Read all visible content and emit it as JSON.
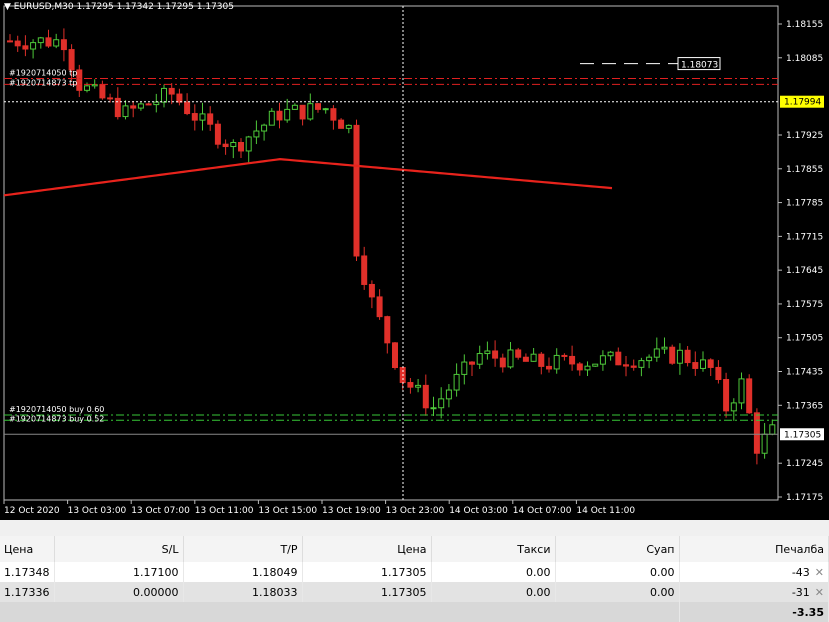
{
  "chart": {
    "symbol": "EURUSD,M30",
    "ohlc": "1.17295 1.17342 1.17295 1.17305",
    "price_ticks": [
      "1.18155",
      "1.18085",
      "1.17925",
      "1.17855",
      "1.17785",
      "1.17715",
      "1.17645",
      "1.17575",
      "1.17505",
      "1.17435",
      "1.17365",
      "1.17245",
      "1.17175"
    ],
    "time_ticks": [
      "12 Oct 2020",
      "13 Oct 03:00",
      "13 Oct 07:00",
      "13 Oct 11:00",
      "13 Oct 15:00",
      "13 Oct 19:00",
      "13 Oct 23:00",
      "14 Oct 03:00",
      "14 Oct 07:00",
      "14 Oct 11:00"
    ],
    "crosshair_price": "1.17994",
    "current_price": "1.17305",
    "tp_price_label": "1.18073",
    "order_tp_labels": [
      "#1920714050 tp",
      "#1920714873 tp"
    ],
    "order_buy_labels": [
      "#1920714050 buy 0.60",
      "#1920714873 buy 0.52"
    ],
    "colors": {
      "bull": "#4ec83a",
      "bear": "#e0302a",
      "ma": "#e8231c",
      "tp_line": "#e02020",
      "buy_line": "#37c837",
      "crosshair": "#ffffff"
    }
  },
  "orders_table": {
    "headers": [
      "Цена",
      "S/L",
      "T/P",
      "Цена",
      "Такси",
      "Суап",
      "Печалба"
    ],
    "rows": [
      [
        "1.17348",
        "1.17100",
        "1.18049",
        "1.17305",
        "0.00",
        "0.00",
        "-43"
      ],
      [
        "1.17336",
        "0.00000",
        "1.18033",
        "1.17305",
        "0.00",
        "0.00",
        "-31"
      ]
    ],
    "total": "-3.35"
  }
}
